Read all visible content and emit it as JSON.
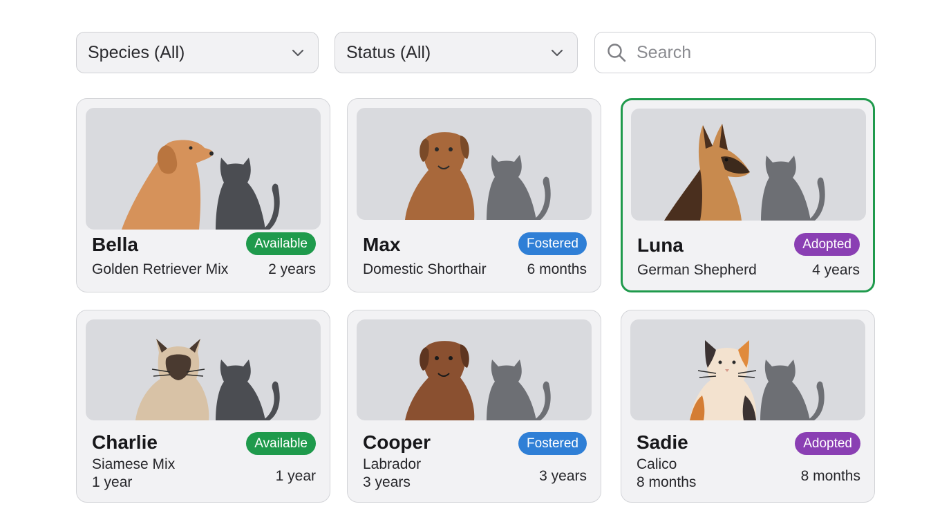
{
  "filters": {
    "species_label": "Species (All)",
    "status_label": "Status (All)",
    "search_placeholder": "Search"
  },
  "colors": {
    "available": "#1f9a4c",
    "fostered": "#2f7fd6",
    "adopted": "#8a3fb3",
    "selected_border": "#1f9a4c"
  },
  "pets": [
    {
      "name": "Bella",
      "breed": "Golden Retriever Mix",
      "age": "2 years",
      "status": "Available",
      "illustration": "golden-retriever-and-cat"
    },
    {
      "name": "Max",
      "breed": "Domestic Shorthair",
      "age": "6 months",
      "status": "Fostered",
      "illustration": "brown-dog-and-cat"
    },
    {
      "name": "Luna",
      "breed": "German Shepherd",
      "age": "4 years",
      "status": "Adopted",
      "illustration": "german-shepherd-and-cat",
      "selected": true
    },
    {
      "name": "Charlie",
      "breed": "Siamese Mix",
      "age_under_breed": "1 year",
      "age": "1 year",
      "status": "Available",
      "illustration": "siamese-cat-and-cat"
    },
    {
      "name": "Cooper",
      "breed": "Labrador",
      "age_under_breed": "3 years",
      "age": "3 years",
      "status": "Fostered",
      "illustration": "labrador-and-cat"
    },
    {
      "name": "Sadie",
      "breed": "Calico",
      "age_under_breed": "8 months",
      "age": "8 months",
      "status": "Adopted",
      "illustration": "calico-cat-and-cat"
    }
  ]
}
